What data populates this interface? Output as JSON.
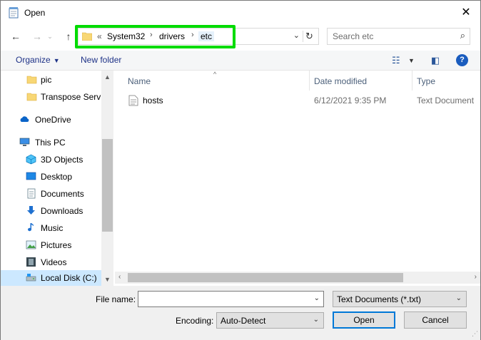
{
  "window": {
    "title": "Open"
  },
  "address": {
    "overflow": "«",
    "crumbs": [
      "System32",
      "drivers",
      "etc"
    ]
  },
  "search": {
    "placeholder": "Search etc"
  },
  "toolbar": {
    "organize": "Organize",
    "new_folder": "New folder"
  },
  "nav": {
    "items": [
      {
        "label": "pic",
        "icon": "folder-icon"
      },
      {
        "label": "Transpose Service",
        "icon": "folder-icon"
      },
      {
        "label": "OneDrive",
        "icon": "cloud-icon"
      },
      {
        "label": "This PC",
        "icon": "computer-icon"
      },
      {
        "label": "3D Objects",
        "icon": "cube-icon"
      },
      {
        "label": "Desktop",
        "icon": "desktop-icon"
      },
      {
        "label": "Documents",
        "icon": "documents-icon"
      },
      {
        "label": "Downloads",
        "icon": "download-arrow-icon"
      },
      {
        "label": "Music",
        "icon": "music-note-icon"
      },
      {
        "label": "Pictures",
        "icon": "pictures-icon"
      },
      {
        "label": "Videos",
        "icon": "film-icon"
      },
      {
        "label": "Local Disk (C:)",
        "icon": "disk-icon"
      }
    ]
  },
  "columns": {
    "name": "Name",
    "date": "Date modified",
    "type": "Type"
  },
  "files": [
    {
      "name": "hosts",
      "date": "6/12/2021 9:35 PM",
      "type": "Text Document"
    }
  ],
  "bottom": {
    "file_name_label": "File name:",
    "file_name_value": "",
    "filter": "Text Documents (*.txt)",
    "encoding_label": "Encoding:",
    "encoding": "Auto-Detect",
    "open": "Open",
    "cancel": "Cancel"
  },
  "colors": {
    "highlight": "#00dc00",
    "selection": "#cce8ff",
    "accent": "#0078d7"
  }
}
